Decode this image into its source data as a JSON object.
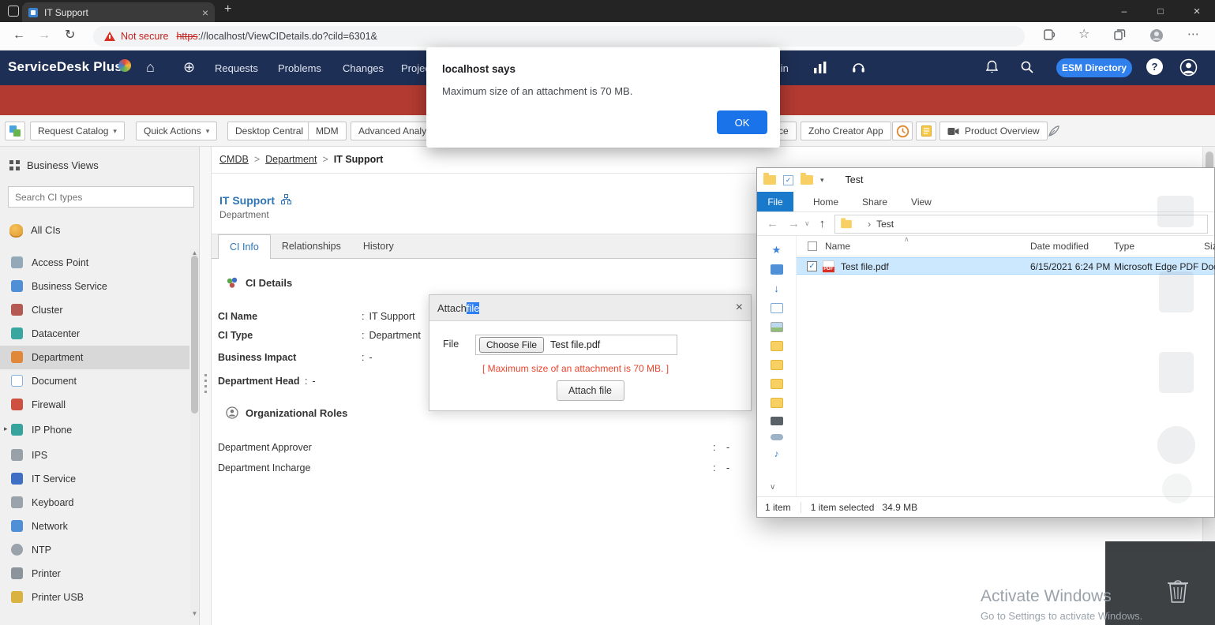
{
  "ui": {
    "colon": ":",
    "crumb_sep": ">"
  },
  "colors": {
    "header_navy": "#1e2f55",
    "banner_red": "#b23a31",
    "esm_blue": "#2f80ed",
    "alert_ok": "#1a73e8",
    "active_tab_blue": "#2e75b6",
    "file_tab_blue": "#1979ca",
    "selection_blue": "#cce8ff"
  },
  "browser": {
    "tab": {
      "title": "IT Support"
    },
    "address": {
      "security": "Not secure",
      "scheme": "https",
      "rest": "://localhost/ViewCIDetails.do?cild=6301&"
    }
  },
  "alert": {
    "title": "localhost says",
    "message": "Maximum size of an attachment is 70 MB.",
    "ok": "OK"
  },
  "app": {
    "brand": "ServiceDesk Plus",
    "nav": [
      "Requests",
      "Problems",
      "Changes",
      "Projects",
      "Admin"
    ],
    "esm": "ESM Directory",
    "help": "?"
  },
  "toolbar": {
    "request_catalog": "Request Catalog",
    "quick_actions": "Quick Actions",
    "desktop_central": "Desktop Central",
    "mdm": "MDM",
    "advanced_analytics": "Advanced Analytics",
    "remote_assistance": "Remote Assistance",
    "zoho_creator": "Zoho Creator App",
    "product_overview": "Product Overview"
  },
  "sidebar": {
    "header": "Business Views",
    "search_placeholder": "Search CI types",
    "all_cis": "All CIs",
    "items": [
      {
        "label": "Access Point",
        "icon": "access-point-icon"
      },
      {
        "label": "Business Service",
        "icon": "business-service-icon"
      },
      {
        "label": "Cluster",
        "icon": "cluster-icon"
      },
      {
        "label": "Datacenter",
        "icon": "datacenter-icon"
      },
      {
        "label": "Department",
        "icon": "department-icon",
        "selected": true
      },
      {
        "label": "Document",
        "icon": "document-icon"
      },
      {
        "label": "Firewall",
        "icon": "firewall-icon"
      },
      {
        "label": "IP Phone",
        "icon": "ip-phone-icon",
        "expandable": true
      },
      {
        "label": "IPS",
        "icon": "ips-icon"
      },
      {
        "label": "IT Service",
        "icon": "it-service-icon"
      },
      {
        "label": "Keyboard",
        "icon": "keyboard-icon"
      },
      {
        "label": "Network",
        "icon": "network-icon"
      },
      {
        "label": "NTP",
        "icon": "ntp-icon"
      },
      {
        "label": "Printer",
        "icon": "printer-icon"
      },
      {
        "label": "Printer USB",
        "icon": "printer-usb-icon"
      }
    ]
  },
  "main": {
    "breadcrumb": {
      "0": "CMDB",
      "1": "Department",
      "2": "IT Support"
    },
    "title": "IT Support",
    "subtitle": "Department",
    "tabs": [
      "CI Info",
      "Relationships",
      "History"
    ],
    "ci_details": {
      "heading": "CI Details",
      "fields": [
        {
          "label": "CI Name",
          "value": "IT Support"
        },
        {
          "label": "CI Type",
          "value": "Department"
        },
        {
          "label": "Business Impact",
          "value": "-"
        },
        {
          "label": "Department Head",
          "value": "-"
        }
      ]
    },
    "org_roles": {
      "heading": "Organizational Roles",
      "rows": [
        {
          "label": "Department Approver",
          "value": "-"
        },
        {
          "label": "Department Incharge",
          "value": "-"
        }
      ]
    }
  },
  "attach_modal": {
    "title_prefix": "Attach ",
    "title_selected": "file",
    "file_label": "File",
    "choose_file": "Choose File",
    "filename": "Test file.pdf",
    "warning": "[ Maximum size of an attachment is 70 MB. ]",
    "attach_button": "Attach file"
  },
  "explorer": {
    "title": "Test",
    "menu": [
      "File",
      "Home",
      "Share",
      "View"
    ],
    "path": "Test",
    "columns": [
      "Name",
      "Date modified",
      "Type",
      "Size"
    ],
    "pdf_badge": "PDF",
    "rows": [
      {
        "name": "Test file.pdf",
        "date": "6/15/2021 6:24 PM",
        "type": "Microsoft Edge PDF Document",
        "icon": "pdf-file-icon"
      }
    ],
    "status_left": "1 item",
    "status_selected": "1 item selected",
    "status_size": "34.9 MB"
  },
  "watermark": {
    "line1": "Activate Windows",
    "line2": "Go to Settings to activate Windows."
  }
}
